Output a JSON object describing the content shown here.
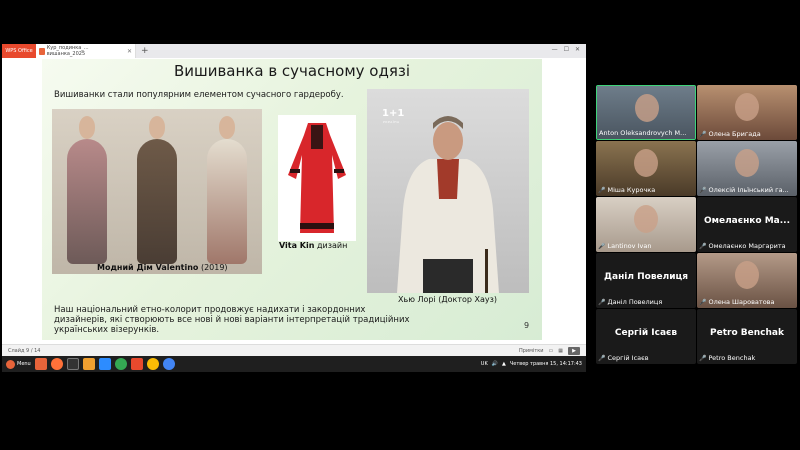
{
  "wps": {
    "logo_label": "WPS Office",
    "tab_label": "Кур_подинка_... вишанка_2025",
    "new_tab": "+",
    "window_controls": [
      "—",
      "☐",
      "✕"
    ]
  },
  "slide": {
    "title": "Вишиванка в сучасному одязі",
    "subtitle": "Вишиванки стали популярним елементом сучасного гардеробу.",
    "caption_valentino_bold": "Модний Дім Valentino",
    "caption_valentino_year": " (2019)",
    "caption_vitakin_bold": "Vita Kin",
    "caption_vitakin_rest": " дизайн",
    "tv_logo": "1+1",
    "tv_logo_sub": "УКРАЇНА",
    "caption_house": "Хью Лорі (Доктор Хауз)",
    "body": "Наш національний етно-колорит продовжує надихати і закордонних дизайнерів, які створюють все нові й нові варіанти інтерпретацій традиційних українських візерунків.",
    "number": "9"
  },
  "statusbar": {
    "slide_counter": "Слайд 9 / 14",
    "notes_label": "Примітки"
  },
  "taskbar": {
    "menu_label": "Menu",
    "lang": "UK",
    "clock": "Четвер травня 15, 14:17:43"
  },
  "participants": [
    {
      "name": "Anton Oleksandrovych M...",
      "video": true,
      "active": true,
      "muted": false
    },
    {
      "name": "Олена Бригада",
      "video": true,
      "active": false,
      "muted": true
    },
    {
      "name": "Міша Курочка",
      "video": true,
      "active": false,
      "muted": true
    },
    {
      "name": "Олексій Ільїнський га...",
      "video": true,
      "active": false,
      "muted": true
    },
    {
      "name": "Lantinov Ivan",
      "video": true,
      "active": false,
      "muted": true
    },
    {
      "name": "Омелаєнко Маргарита",
      "big": "Омелаєнко Ма...",
      "video": false,
      "active": false,
      "muted": true
    },
    {
      "name": "Даніл Повелиця",
      "big": "Даніл Повелиця",
      "video": false,
      "active": false,
      "muted": true
    },
    {
      "name": "Олена Шароватова",
      "video": true,
      "active": false,
      "muted": true
    },
    {
      "name": "Сергій Ісаєв",
      "big": "Сергій Ісаєв",
      "video": false,
      "active": false,
      "muted": true
    },
    {
      "name": "Petro Benchak",
      "big": "Petro Benchak",
      "video": false,
      "active": false,
      "muted": true
    }
  ],
  "colors": {
    "active_border": "#3fd47a",
    "muted_icon": "#e03131",
    "wps_accent": "#e8492d"
  }
}
